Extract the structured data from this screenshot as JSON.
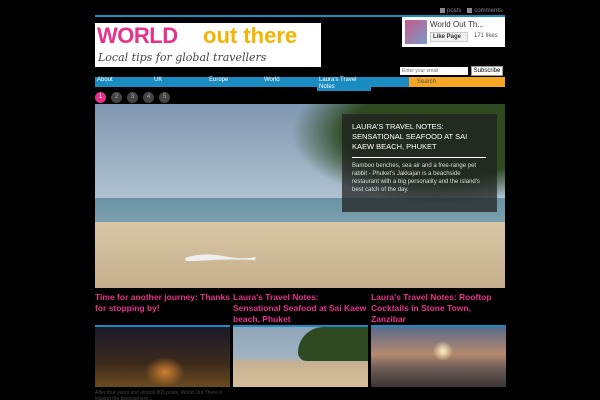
{
  "header": {
    "feed_posts": "posts",
    "feed_comments": "comments",
    "logo_word1": "WORLD",
    "logo_word2": "out there",
    "tagline": "Local tips for global travellers"
  },
  "facebook": {
    "page_name": "World Out Th...",
    "like_label": "Like Page",
    "likes": "171 likes"
  },
  "subscribe": {
    "placeholder": "Enter your email",
    "button": "Subscribe"
  },
  "nav": {
    "items": [
      "About",
      "UK",
      "Europe",
      "World",
      "Laura's Travel Notes"
    ],
    "search_placeholder": "Search"
  },
  "pager": {
    "pages": [
      "1",
      "2",
      "3",
      "4",
      "5"
    ],
    "active": "1"
  },
  "hero": {
    "title": "LAURA'S TRAVEL NOTES: SENSATIONAL SEAFOOD AT SAI KAEW BEACH, PHUKET",
    "text": "Bamboo benches, sea air and a free-range pet rabbit - Phuket's Jakkajan is a beachside restaurant with a big personality and the island's best catch of the day."
  },
  "cards": [
    {
      "title": "Time for another journey: Thanks for stopping by!",
      "text": "After four years and almost 800 posts, World Out There is leaving the blogosphere..."
    },
    {
      "title": "Laura's Travel Notes: Sensational Seafood at Sai Kaew beach, Phuket",
      "text": ""
    },
    {
      "title": "Laura's Travel Notes: Rooftop Cocktails in Stone Town, Zanzibar",
      "text": ""
    }
  ],
  "colors": {
    "accent_pink": "#e6328c",
    "accent_blue": "#1a8cc1",
    "accent_orange": "#f5a623"
  }
}
